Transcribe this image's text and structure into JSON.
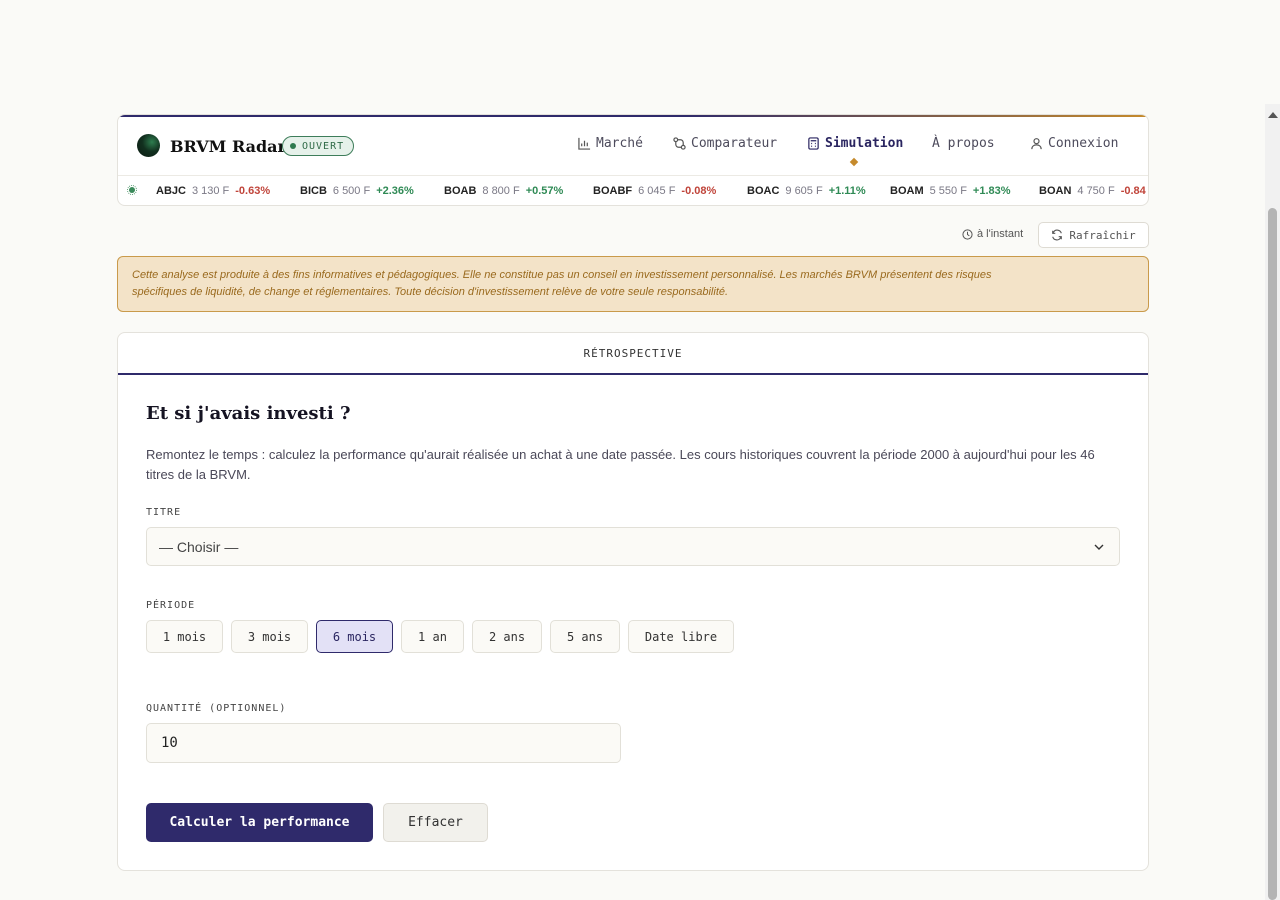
{
  "header": {
    "brand": "BRVM Radar",
    "status": "OUVERT",
    "nav": [
      {
        "label": "Marché",
        "icon": "bar-chart-icon"
      },
      {
        "label": "Comparateur",
        "icon": "compare-icon"
      },
      {
        "label": "Simulation",
        "icon": "calculator-icon",
        "active": true
      },
      {
        "label": "À propos"
      },
      {
        "label": "Connexion",
        "icon": "user-icon"
      }
    ]
  },
  "ticker": [
    {
      "symbol": "ABJC",
      "price": "3 130 F",
      "change": "-0.63%",
      "direction": "down"
    },
    {
      "symbol": "BICB",
      "price": "6 500 F",
      "change": "+2.36%",
      "direction": "up"
    },
    {
      "symbol": "BOAB",
      "price": "8 800 F",
      "change": "+0.57%",
      "direction": "up"
    },
    {
      "symbol": "BOABF",
      "price": "6 045 F",
      "change": "-0.08%",
      "direction": "down"
    },
    {
      "symbol": "BOAC",
      "price": "9 605 F",
      "change": "+1.11%",
      "direction": "up"
    },
    {
      "symbol": "BOAM",
      "price": "5 550 F",
      "change": "+1.83%",
      "direction": "up"
    },
    {
      "symbol": "BOAN",
      "price": "4 750 F",
      "change": "-0.84",
      "direction": "down"
    }
  ],
  "toolbar": {
    "updated": "à l'instant",
    "refresh_label": "Rafraîchir"
  },
  "disclaimer": {
    "line1": "Cette analyse est produite à des fins informatives et pédagogiques. Elle ne constitue pas un conseil en investissement personnalisé. Les marchés BRVM présentent des risques",
    "line2": "spécifiques de liquidité, de change et réglementaires. Toute décision d'investissement relève de votre seule responsabilité."
  },
  "card": {
    "tab": "RÉTROSPECTIVE",
    "title": "Et si j'avais investi ?",
    "description": "Remontez le temps : calculez la performance qu'aurait réalisée un achat à une date passée. Les cours historiques couvrent la période 2000 à aujourd'hui pour les 46 titres de la BRVM.",
    "titre_label": "TITRE",
    "titre_value": "— Choisir —",
    "periode_label": "PÉRIODE",
    "periods": [
      "1 mois",
      "3 mois",
      "6 mois",
      "1 an",
      "2 ans",
      "5 ans",
      "Date libre"
    ],
    "selected_period": "6 mois",
    "quantite_label": "QUANTITÉ (OPTIONNEL)",
    "quantite_value": "10",
    "submit_label": "Calculer la performance",
    "clear_label": "Effacer"
  },
  "colors": {
    "accent": "#2f2a6b",
    "gold": "#c58a2c",
    "up": "#2f8a55",
    "down": "#c0443a"
  }
}
